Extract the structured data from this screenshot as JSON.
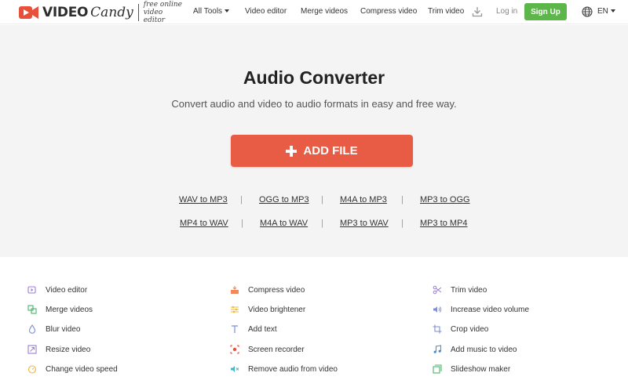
{
  "header": {
    "logo_word": "VIDEO",
    "logo_candy": "Candy",
    "logo_tagline": "free online video editor",
    "nav": [
      {
        "label": "All Tools",
        "has_caret": true
      },
      {
        "label": "Video editor"
      },
      {
        "label": "Merge videos"
      },
      {
        "label": "Compress video"
      },
      {
        "label": "Trim video"
      }
    ],
    "login_label": "Log in",
    "signup_label": "Sign Up",
    "language": "EN",
    "colors": {
      "logo_red": "#e8503a",
      "signup_green": "#5cb64a"
    }
  },
  "hero": {
    "title": "Audio Converter",
    "subtitle": "Convert audio and video to audio formats in easy and free way.",
    "add_file_label": "ADD FILE",
    "button_color": "#e85c45",
    "conversion_rows": [
      [
        "WAV to MP3",
        "OGG to MP3",
        "M4A to MP3",
        "MP3 to OGG"
      ],
      [
        "MP4 to WAV",
        "M4A to WAV",
        "MP3 to WAV",
        "MP3 to MP4"
      ]
    ],
    "separator": "|"
  },
  "tools": {
    "columns": [
      [
        {
          "label": "Video editor",
          "icon": "video-edit-icon",
          "color": "#9b7fd4"
        },
        {
          "label": "Merge videos",
          "icon": "merge-icon",
          "color": "#4ab56a"
        },
        {
          "label": "Blur video",
          "icon": "droplet-icon",
          "color": "#7c8fd6"
        },
        {
          "label": "Resize video",
          "icon": "resize-icon",
          "color": "#9b7fd4"
        },
        {
          "label": "Change video speed",
          "icon": "speed-icon",
          "color": "#f0b93a"
        }
      ],
      [
        {
          "label": "Compress video",
          "icon": "compress-icon",
          "color": "#f08a5d"
        },
        {
          "label": "Video brightener",
          "icon": "sliders-icon",
          "color": "#f0b93a"
        },
        {
          "label": "Add text",
          "icon": "text-icon",
          "color": "#7c8fd6"
        },
        {
          "label": "Screen recorder",
          "icon": "record-icon",
          "color": "#e8503a"
        },
        {
          "label": "Remove audio from video",
          "icon": "mute-icon",
          "color": "#4ab5c4"
        }
      ],
      [
        {
          "label": "Trim video",
          "icon": "scissors-icon",
          "color": "#9b7fd4"
        },
        {
          "label": "Increase video volume",
          "icon": "volume-icon",
          "color": "#7c8fd6"
        },
        {
          "label": "Crop video",
          "icon": "crop-icon",
          "color": "#7c8fd6"
        },
        {
          "label": "Add music to video",
          "icon": "music-icon",
          "color": "#4a8fd6"
        },
        {
          "label": "Slideshow maker",
          "icon": "slideshow-icon",
          "color": "#4ab56a"
        }
      ]
    ]
  }
}
